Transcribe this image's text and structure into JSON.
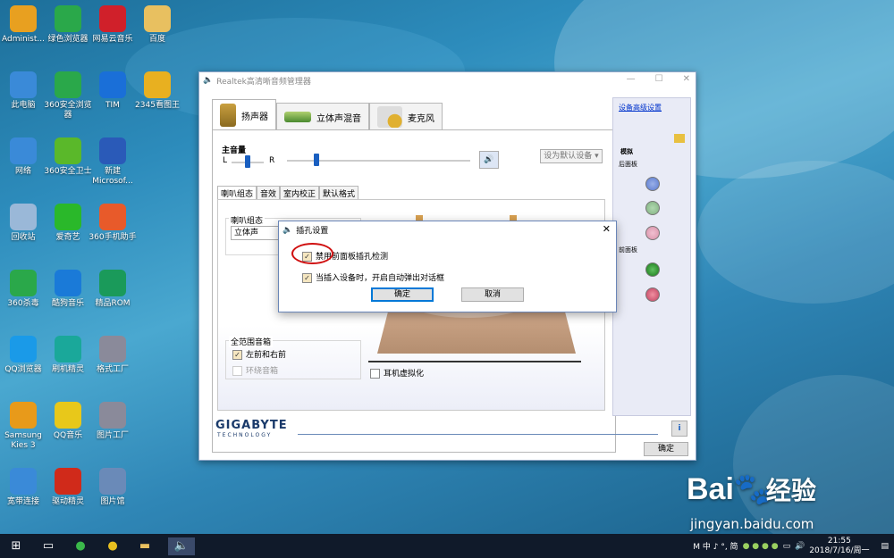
{
  "desktop": {
    "icons": [
      {
        "label": "Administ...",
        "icon": "user-folder-icon",
        "color": "#e8a020"
      },
      {
        "label": "绿色浏览器",
        "icon": "green-browser-icon",
        "color": "#2aa84a"
      },
      {
        "label": "网易云音乐",
        "icon": "netease-music-icon",
        "color": "#d0202a"
      },
      {
        "label": "百度",
        "icon": "folder-icon",
        "color": "#e8c060"
      },
      {
        "label": "此电脑",
        "icon": "computer-icon",
        "color": "#3a8ad8"
      },
      {
        "label": "360安全浏览器",
        "icon": "360-browser-icon",
        "color": "#2aa84a"
      },
      {
        "label": "TIM",
        "icon": "tim-icon",
        "color": "#1a6fd8"
      },
      {
        "label": "2345看图王",
        "icon": "image-viewer-icon",
        "color": "#e8b020"
      },
      {
        "label": "网络",
        "icon": "network-icon",
        "color": "#3a8ad8"
      },
      {
        "label": "360安全卫士",
        "icon": "360-security-icon",
        "color": "#5ab82a"
      },
      {
        "label": "新建\nMicrosof...",
        "icon": "word-doc-icon",
        "color": "#2a5ab8"
      },
      {
        "label": "回收站",
        "icon": "recycle-bin-icon",
        "color": "#9ab8d8"
      },
      {
        "label": "爱奇艺",
        "icon": "iqiyi-icon",
        "color": "#2ab82a"
      },
      {
        "label": "360手机助手",
        "icon": "360-phone-icon",
        "color": "#e85a2a"
      },
      {
        "label": "360杀毒",
        "icon": "360-antivirus-icon",
        "color": "#2aa84a"
      },
      {
        "label": "酷狗音乐",
        "icon": "kugou-icon",
        "color": "#1a7ad8"
      },
      {
        "label": "精品ROM",
        "icon": "rom-icon",
        "color": "#1a9a5a"
      },
      {
        "label": "QQ浏览器",
        "icon": "qq-browser-icon",
        "color": "#1a9ae8"
      },
      {
        "label": "刷机精灵",
        "icon": "flash-icon",
        "color": "#1aa89a"
      },
      {
        "label": "格式工厂",
        "icon": "format-factory-icon",
        "color": "#8a8a9a"
      },
      {
        "label": "Samsung\nKies 3",
        "icon": "kies-icon",
        "color": "#e89a1a"
      },
      {
        "label": "QQ音乐",
        "icon": "qq-music-icon",
        "color": "#e8c81a"
      },
      {
        "label": "图片工厂",
        "icon": "picture-factory-icon",
        "color": "#8a8a9a"
      },
      {
        "label": "宽带连接",
        "icon": "broadband-icon",
        "color": "#3a8ad8"
      },
      {
        "label": "驱动精灵",
        "icon": "driver-icon",
        "color": "#d02a1a"
      },
      {
        "label": "图片馆",
        "icon": "picture-gallery-icon",
        "color": "#6a8ab8"
      }
    ]
  },
  "window": {
    "title": "Realtek高清晰音频管理器",
    "tabs": [
      "扬声器",
      "立体声混音",
      "麦克风"
    ],
    "main_volume_label": "主音量",
    "left_label": "L",
    "right_label": "R",
    "set_default_label": "设为默认设备",
    "inner_tabs": [
      "喇叭组态",
      "音效",
      "室内校正",
      "默认格式"
    ],
    "speaker_config_group": "喇叭组态",
    "speaker_config_value": "立体声",
    "fullrange_group": "全范围音箱",
    "front_lr_label": "左前和右前",
    "surround_label": "环绕音箱",
    "headphone_virtual_label": "耳机虚拟化",
    "advanced_link": "设备高级设置",
    "analog_label": "模拟",
    "back_panel_label": "后面板",
    "front_panel_label": "前面板",
    "brand": "GIGABYTE",
    "brand_sub": "TECHNOLOGY",
    "ok_label": "确定",
    "info_label": "i"
  },
  "dialog": {
    "title": "插孔设置",
    "option1": "禁用前面板插孔检测",
    "option2": "当插入设备时，开启自动弹出对话框",
    "ok": "确定",
    "cancel": "取消"
  },
  "taskbar": {
    "tray_text": "M 中 ♪ °, 简",
    "time": "21:55",
    "date": "2018/7/16/周一"
  },
  "watermark": {
    "brand": "Bai",
    "brand2": "经验",
    "url": "jingyan.baidu.com"
  },
  "colors": {
    "accent": "#0078d7",
    "jack_blue": "#5a7ad0",
    "jack_green": "#3a9a3a",
    "jack_pink": "#e07a9a"
  }
}
